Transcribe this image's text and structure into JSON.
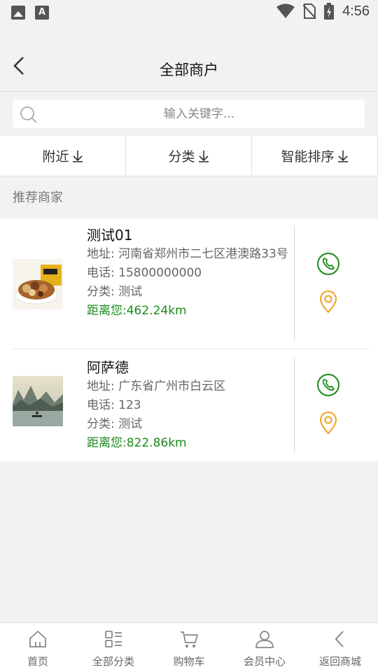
{
  "status_bar": {
    "time": "4:56",
    "left_icons": [
      "image-icon",
      "text-icon"
    ],
    "right_icons": [
      "wifi-icon",
      "no-sim-icon",
      "battery-icon"
    ]
  },
  "header": {
    "title": "全部商户"
  },
  "search": {
    "placeholder": "输入关键字..."
  },
  "filters": [
    {
      "label": "附近",
      "icon": "arrow-down-icon"
    },
    {
      "label": "分类",
      "icon": "arrow-down-icon"
    },
    {
      "label": "智能排序",
      "icon": "arrow-down-icon"
    }
  ],
  "section": {
    "label": "推荐商家"
  },
  "merchants": [
    {
      "name": "测试01",
      "address": "地址: 河南省郑州市二七区港澳路33号",
      "phone": "电话: 15800000000",
      "category": "分类: 测试",
      "distance": "距离您:462.24km"
    },
    {
      "name": "阿萨德",
      "address": "地址: 广东省广州市白云区",
      "phone": "电话: 123",
      "category": "分类: 测试",
      "distance": "距离您:822.86km"
    }
  ],
  "tabs": [
    {
      "label": "首页",
      "icon": "home-icon"
    },
    {
      "label": "全部分类",
      "icon": "category-icon"
    },
    {
      "label": "购物车",
      "icon": "cart-icon"
    },
    {
      "label": "会员中心",
      "icon": "user-icon"
    },
    {
      "label": "返回商城",
      "icon": "back-icon"
    }
  ],
  "colors": {
    "phone": "#1a8a1a",
    "location": "#f0a020",
    "distance": "#1a8a1a"
  }
}
